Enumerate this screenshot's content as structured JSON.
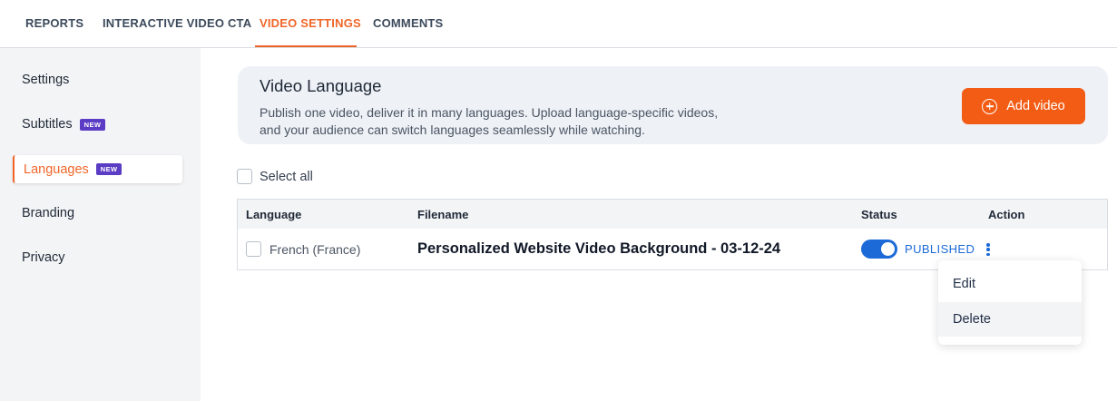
{
  "tabs": [
    {
      "label": "REPORTS"
    },
    {
      "label": "INTERACTIVE VIDEO CTA"
    },
    {
      "label": "VIDEO SETTINGS",
      "active": true
    },
    {
      "label": "COMMENTS"
    }
  ],
  "sidebar": {
    "items": [
      {
        "label": "Settings"
      },
      {
        "label": "Subtitles",
        "badge": "NEW"
      },
      {
        "label": "Languages",
        "badge": "NEW",
        "active": true
      },
      {
        "label": "Branding"
      },
      {
        "label": "Privacy"
      }
    ]
  },
  "header": {
    "title": "Video Language",
    "description": "Publish one video, deliver it in many languages. Upload language-specific videos, and your audience can switch languages seamlessly while watching.",
    "add_button_label": "Add video",
    "add_button_icon": "plus-circle-icon"
  },
  "select_all_label": "Select all",
  "table": {
    "columns": [
      "Language",
      "Filename",
      "Status",
      "Action"
    ],
    "rows": [
      {
        "language": "French (France)",
        "filename": "Personalized Website Video Background - 03-12-24",
        "status": "PUBLISHED",
        "published_toggle_on": true
      }
    ]
  },
  "action_menu": {
    "items": [
      "Edit",
      "Delete"
    ]
  },
  "colors": {
    "accent": "#f0662a",
    "button": "#f35c14",
    "badge": "#5b3cc4",
    "status_blue": "#1c6ad8"
  }
}
